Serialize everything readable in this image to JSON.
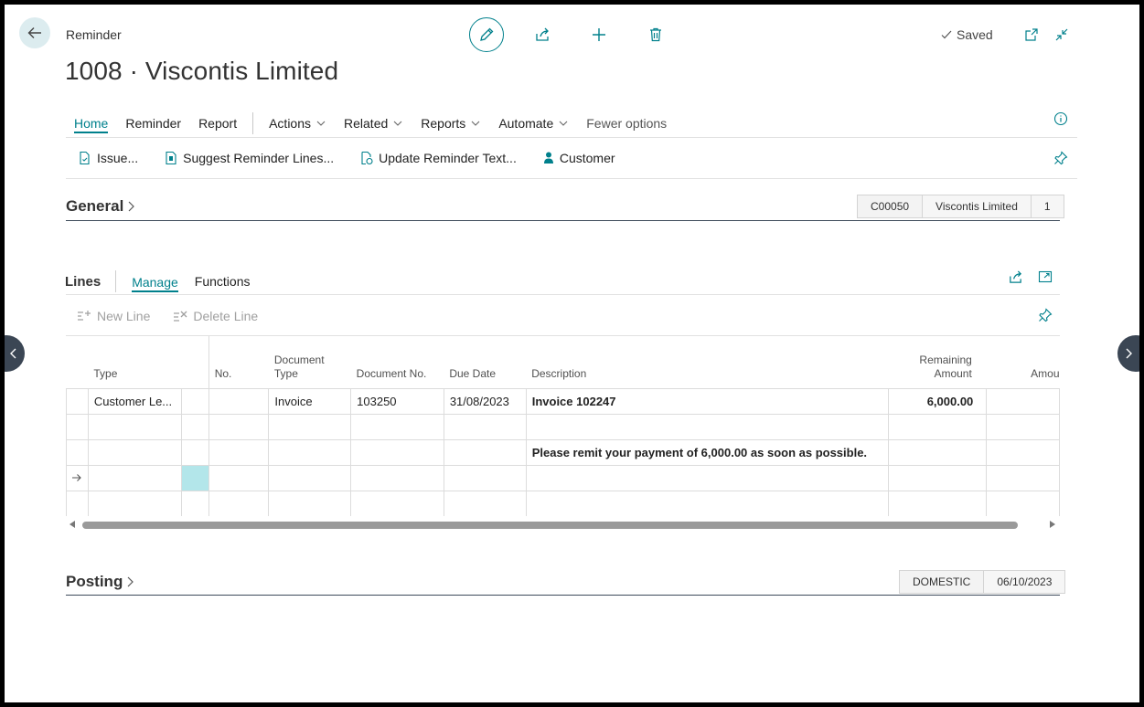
{
  "header": {
    "breadcrumb": "Reminder",
    "title": "1008 · Viscontis Limited",
    "status": "Saved"
  },
  "menu": {
    "items": [
      {
        "label": "Home",
        "active": true
      },
      {
        "label": "Reminder"
      },
      {
        "label": "Report"
      },
      {
        "label": "Actions",
        "dropdown": true
      },
      {
        "label": "Related",
        "dropdown": true
      },
      {
        "label": "Reports",
        "dropdown": true
      },
      {
        "label": "Automate",
        "dropdown": true
      },
      {
        "label": "Fewer options"
      }
    ]
  },
  "promoted": {
    "issue": "Issue...",
    "suggest": "Suggest Reminder Lines...",
    "update_text": "Update Reminder Text...",
    "customer": "Customer"
  },
  "general": {
    "title": "General",
    "badges": [
      "C00050",
      "Viscontis Limited",
      "1"
    ]
  },
  "lines": {
    "title": "Lines",
    "tabs": [
      "Manage",
      "Functions"
    ],
    "actions": {
      "new_line": "New Line",
      "delete_line": "Delete Line"
    },
    "columns": [
      "Type",
      "No.",
      "Document Type",
      "Document No.",
      "Due Date",
      "Description",
      "Remaining Amount",
      "Amou"
    ],
    "rows": [
      {
        "type": "Customer Le...",
        "no": "",
        "doc_type": "Invoice",
        "doc_no": "103250",
        "due_date": "31/08/2023",
        "description": "Invoice 102247",
        "remaining": "6,000.00",
        "amount": ""
      },
      {
        "type": "",
        "no": "",
        "doc_type": "",
        "doc_no": "",
        "due_date": "",
        "description": "",
        "remaining": "",
        "amount": ""
      },
      {
        "type": "",
        "no": "",
        "doc_type": "",
        "doc_no": "",
        "due_date": "",
        "description": "Please remit your payment of 6,000.00 as soon as possible.",
        "remaining": "",
        "amount": ""
      },
      {
        "type": "",
        "no": "",
        "doc_type": "",
        "doc_no": "",
        "due_date": "",
        "description": "",
        "remaining": "",
        "amount": ""
      },
      {
        "type": "",
        "no": "",
        "doc_type": "",
        "doc_no": "",
        "due_date": "",
        "description": "",
        "remaining": "",
        "amount": ""
      }
    ]
  },
  "posting": {
    "title": "Posting",
    "badges": [
      "DOMESTIC",
      "06/10/2023"
    ]
  },
  "colors": {
    "accent": "#00808c",
    "selected_cell": "#b3e6ea"
  }
}
